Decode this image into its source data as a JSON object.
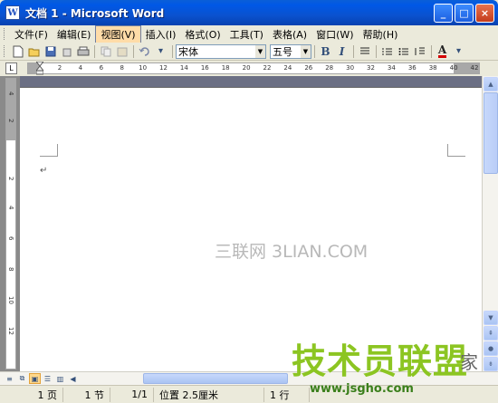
{
  "window": {
    "title": "文档 1 - Microsoft Word",
    "icon_letter": "W",
    "controls": [
      "_",
      "□",
      "×"
    ]
  },
  "menu": {
    "items": [
      "文件(F)",
      "编辑(E)",
      "视图(V)",
      "插入(I)",
      "格式(O)",
      "工具(T)",
      "表格(A)",
      "窗口(W)",
      "帮助(H)"
    ],
    "active_index": 2
  },
  "toolbar": {
    "font_name": "宋体",
    "font_size": "五号",
    "bold_label": "B",
    "italic_label": "I",
    "font_color_label": "A",
    "font_color": "#d40000"
  },
  "ruler": {
    "tab_selector": "L",
    "ticks": [
      "2",
      "4",
      "6",
      "8",
      "10",
      "12",
      "14",
      "16",
      "18",
      "20",
      "22",
      "24",
      "26",
      "28",
      "30",
      "32",
      "34",
      "36",
      "38",
      "40",
      "42"
    ]
  },
  "vertical_ruler": {
    "ticks": [
      "4",
      "2",
      "2",
      "4",
      "6",
      "8",
      "10",
      "12"
    ]
  },
  "document": {
    "paragraph_mark": "↵",
    "watermark": "三联网 3LIAN.COM"
  },
  "statusbar": {
    "page": "1 页",
    "section": "1 节",
    "page_of": "1/1",
    "position": "位置 2.5厘米",
    "line": "1 行"
  },
  "logo": {
    "text": "技术员联盟",
    "url": "www.jsgho.com",
    "extra": "家",
    "accent": "#8cc522"
  }
}
